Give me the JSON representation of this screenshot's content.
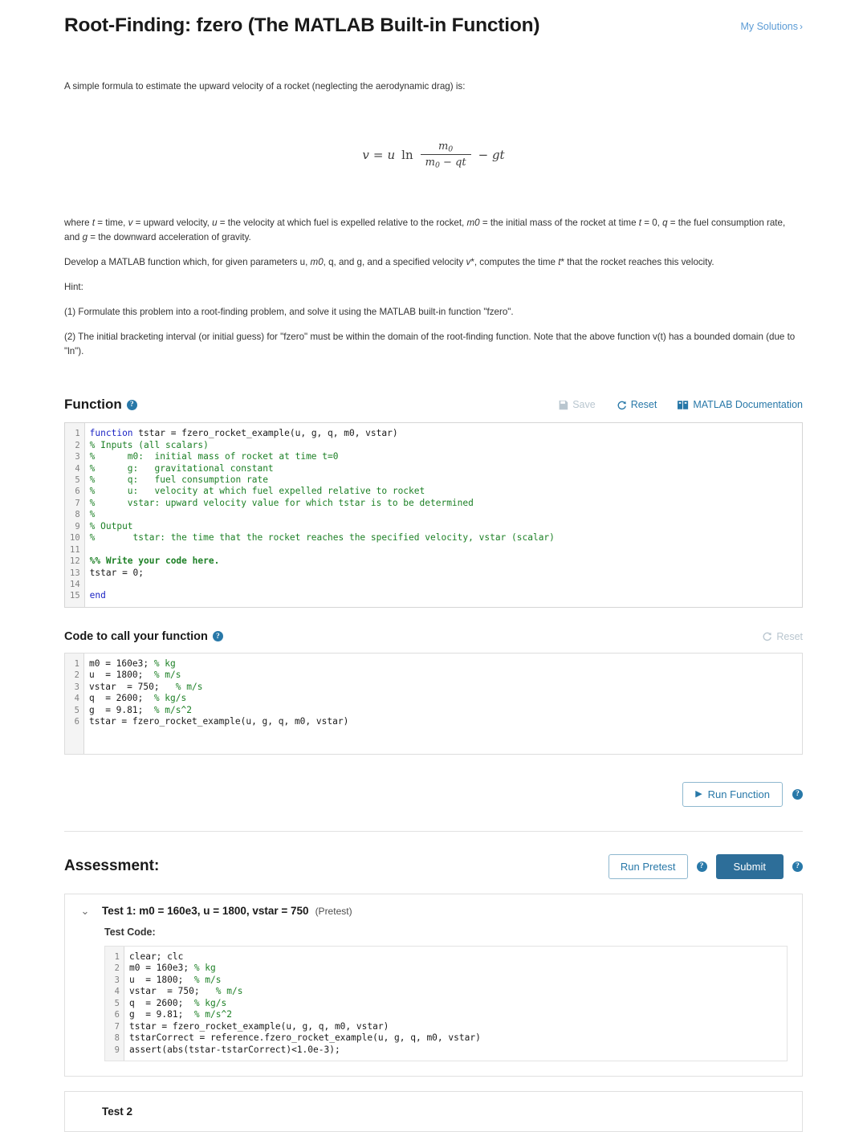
{
  "header": {
    "title": "Root-Finding: fzero (The MATLAB Built-in Function)",
    "my_solutions": "My Solutions",
    "my_solutions_chevron": "›"
  },
  "intro": {
    "lead": "A simple formula to estimate the upward velocity of a rocket (neglecting the aerodynamic drag) is:",
    "formula": {
      "lhs": "v",
      "eq": "=",
      "u": "u",
      "ln": "ln",
      "numerator": "m0",
      "denominator": "m0 − qt",
      "tail": "− gt",
      "plain": "v = u ln( m0 / (m0 - qt) ) - gt"
    },
    "paragraphs": [
      "where t = time, v = upward velocity, u = the velocity at which fuel is expelled relative to the rocket, m0 = the initial mass of the rocket at time t = 0, q = the fuel consumption rate, and g = the downward acceleration of gravity.",
      "Develop a MATLAB function which, for given parameters u, m0, q, and g, and a specified velocity v*, computes the time t* that the rocket reaches this velocity.",
      "Hint:",
      "(1) Formulate this problem into a root-finding problem, and solve it using the MATLAB built-in function \"fzero\".",
      "(2) The initial bracketing interval (or initial guess) for \"fzero\" must be within the domain of the root-finding function. Note that the above function v(t) has a bounded domain (due to \"ln\")."
    ]
  },
  "function_section": {
    "title": "Function",
    "help_glyph": "?",
    "toolbar": {
      "save_label": "Save",
      "reset_label": "Reset",
      "docs_label": "MATLAB Documentation"
    },
    "code_lines": [
      {
        "n": "1",
        "segments": [
          {
            "t": "function ",
            "c": "kw"
          },
          {
            "t": "tstar = fzero_rocket_example(u, g, q, m0, vstar)",
            "c": ""
          }
        ]
      },
      {
        "n": "2",
        "segments": [
          {
            "t": "% Inputs (all scalars)",
            "c": "cm"
          }
        ]
      },
      {
        "n": "3",
        "segments": [
          {
            "t": "%      m0:  initial mass of rocket at time t=0",
            "c": "cm"
          }
        ]
      },
      {
        "n": "4",
        "segments": [
          {
            "t": "%      g:   gravitational constant",
            "c": "cm"
          }
        ]
      },
      {
        "n": "5",
        "segments": [
          {
            "t": "%      q:   fuel consumption rate",
            "c": "cm"
          }
        ]
      },
      {
        "n": "6",
        "segments": [
          {
            "t": "%      u:   velocity at which fuel expelled relative to rocket",
            "c": "cm"
          }
        ]
      },
      {
        "n": "7",
        "segments": [
          {
            "t": "%      vstar: upward velocity value for which tstar is to be determined",
            "c": "cm"
          }
        ]
      },
      {
        "n": "8",
        "segments": [
          {
            "t": "%",
            "c": "cm"
          }
        ]
      },
      {
        "n": "9",
        "segments": [
          {
            "t": "% Output",
            "c": "cm"
          }
        ]
      },
      {
        "n": "10",
        "segments": [
          {
            "t": "%       tstar: the time that the rocket reaches the specified velocity, vstar (scalar)",
            "c": "cm"
          }
        ]
      },
      {
        "n": "11",
        "segments": [
          {
            "t": "",
            "c": ""
          }
        ]
      },
      {
        "n": "12",
        "segments": [
          {
            "t": "%% Write your code here.",
            "c": "cmb"
          }
        ]
      },
      {
        "n": "13",
        "segments": [
          {
            "t": "tstar = 0;",
            "c": ""
          }
        ]
      },
      {
        "n": "14",
        "segments": [
          {
            "t": "",
            "c": ""
          }
        ]
      },
      {
        "n": "15",
        "segments": [
          {
            "t": "end",
            "c": "kw"
          }
        ]
      }
    ]
  },
  "call_section": {
    "title": "Code to call your function",
    "help_glyph": "?",
    "reset_label": "Reset",
    "code_lines": [
      {
        "n": "1",
        "segments": [
          {
            "t": "m0 = 160e3; ",
            "c": ""
          },
          {
            "t": "% kg",
            "c": "cm"
          }
        ]
      },
      {
        "n": "2",
        "segments": [
          {
            "t": "u  = 1800;  ",
            "c": ""
          },
          {
            "t": "% m/s",
            "c": "cm"
          }
        ]
      },
      {
        "n": "3",
        "segments": [
          {
            "t": "vstar  = 750;   ",
            "c": ""
          },
          {
            "t": "% m/s",
            "c": "cm"
          }
        ]
      },
      {
        "n": "4",
        "segments": [
          {
            "t": "q  = 2600;  ",
            "c": ""
          },
          {
            "t": "% kg/s",
            "c": "cm"
          }
        ]
      },
      {
        "n": "5",
        "segments": [
          {
            "t": "g  = 9.81;  ",
            "c": ""
          },
          {
            "t": "% m/s^2",
            "c": "cm"
          }
        ]
      },
      {
        "n": "6",
        "segments": [
          {
            "t": "tstar = fzero_rocket_example(u, g, q, m0, vstar)",
            "c": ""
          }
        ]
      }
    ],
    "run_button": "Run Function",
    "run_icon": "▶",
    "run_help_glyph": "?"
  },
  "assessment": {
    "title": "Assessment:",
    "run_pretest_label": "Run Pretest",
    "run_pretest_help_glyph": "?",
    "submit_label": "Submit",
    "submit_help_glyph": "?",
    "tests": [
      {
        "chevron": "⌄",
        "title": "Test 1: m0 = 160e3, u = 1800, vstar = 750",
        "tag": "(Pretest)",
        "code_label": "Test Code:",
        "code_lines": [
          {
            "n": "1",
            "segments": [
              {
                "t": "clear; clc",
                "c": ""
              }
            ]
          },
          {
            "n": "2",
            "segments": [
              {
                "t": "m0 = 160e3; ",
                "c": ""
              },
              {
                "t": "% kg",
                "c": "cm"
              }
            ]
          },
          {
            "n": "3",
            "segments": [
              {
                "t": "u  = 1800;  ",
                "c": ""
              },
              {
                "t": "% m/s",
                "c": "cm"
              }
            ]
          },
          {
            "n": "4",
            "segments": [
              {
                "t": "vstar  = 750;   ",
                "c": ""
              },
              {
                "t": "% m/s",
                "c": "cm"
              }
            ]
          },
          {
            "n": "5",
            "segments": [
              {
                "t": "q  = 2600;  ",
                "c": ""
              },
              {
                "t": "% kg/s",
                "c": "cm"
              }
            ]
          },
          {
            "n": "6",
            "segments": [
              {
                "t": "g  = 9.81;  ",
                "c": ""
              },
              {
                "t": "% m/s^2",
                "c": "cm"
              }
            ]
          },
          {
            "n": "7",
            "segments": [
              {
                "t": "tstar = fzero_rocket_example(u, g, q, m0, vstar)",
                "c": ""
              }
            ]
          },
          {
            "n": "8",
            "segments": [
              {
                "t": "tstarCorrect = reference.fzero_rocket_example(u, g, q, m0, vstar)",
                "c": ""
              }
            ]
          },
          {
            "n": "9",
            "segments": [
              {
                "t": "assert(abs(tstar-tstarCorrect)<1.0e-3);",
                "c": ""
              }
            ]
          }
        ]
      },
      {
        "chevron": "",
        "title": "Test 2",
        "tag": "",
        "code_label": "",
        "code_lines": []
      }
    ]
  },
  "colors": {
    "link": "#2878a8",
    "link_light": "#5b9bd5",
    "primary": "#2d6e99",
    "disabled": "#b9c6cf",
    "keyword": "#1c24c4",
    "comment": "#1d8026"
  }
}
